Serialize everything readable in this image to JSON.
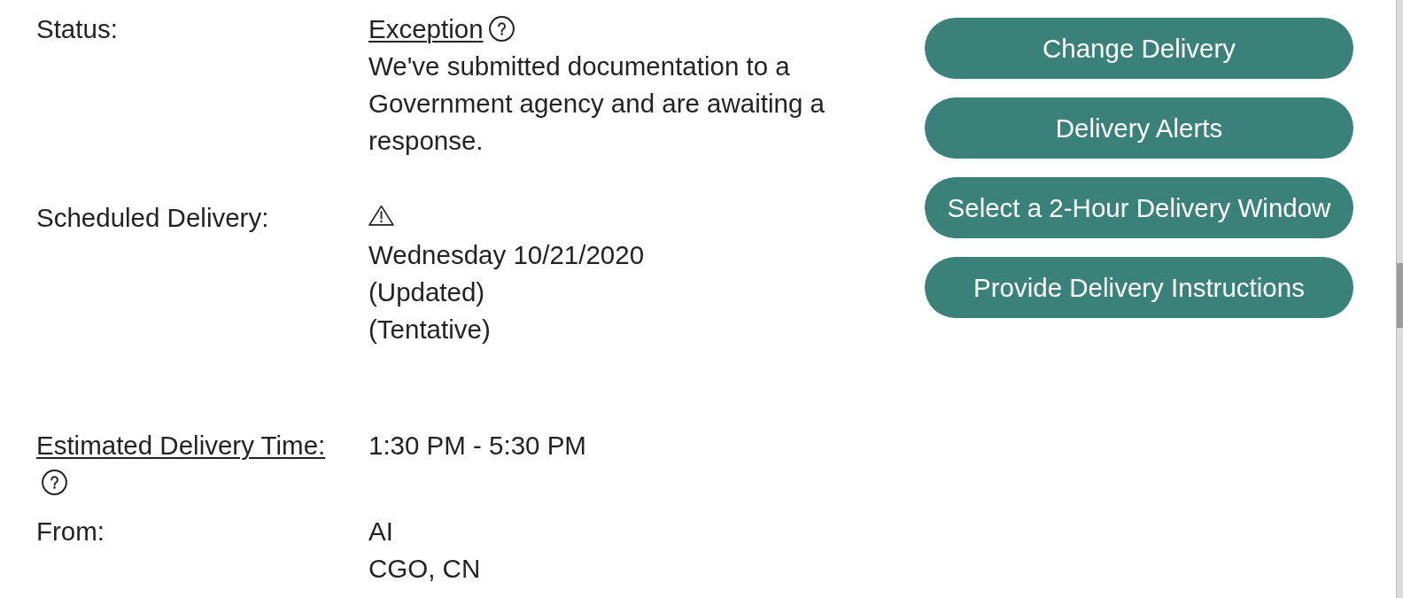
{
  "details": [
    {
      "label": "Status:",
      "status_link": "Exception",
      "status_help": true,
      "description": "We've submitted documentation to a Government agency and are awaiting a response."
    },
    {
      "label": "Scheduled Delivery:",
      "warning": true,
      "lines": [
        "Wednesday 10/21/2020",
        "(Updated)",
        "(Tentative)"
      ]
    },
    {
      "label": "Estimated Delivery Time:",
      "label_link": true,
      "label_help": true,
      "lines": [
        "1:30 PM - 5:30 PM"
      ]
    },
    {
      "label": "From:",
      "lines": [
        "AI",
        "CGO, CN"
      ]
    }
  ],
  "actions": [
    "Change Delivery",
    "Delivery Alerts",
    "Select a 2-Hour Delivery Window",
    "Provide Delivery Instructions"
  ]
}
